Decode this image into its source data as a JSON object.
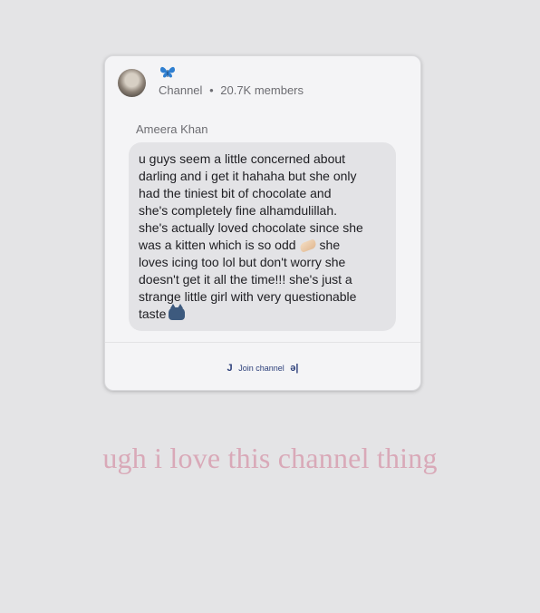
{
  "channel": {
    "label": "Channel",
    "separator": "•",
    "members": "20.7K members"
  },
  "message": {
    "author": "Ameera Khan",
    "lines": [
      "u guys seem a little concerned about",
      "darling and i get it hahaha but she only",
      "had the tiniest bit of chocolate and",
      "she's completely fine alhamdulillah.",
      "she's actually loved chocolate since she",
      "was a kitten which is so odd",
      "she",
      "loves icing too lol but don't worry she",
      "doesn't get it all the time!!! she's just a",
      "strange little girl with very questionable",
      "taste"
    ]
  },
  "join": {
    "left_glyph": "J",
    "label": "Join channel",
    "right_glyph": "ǝ|"
  },
  "caption": "ugh i love this channel thing",
  "colors": {
    "background": "#e4e4e6",
    "card": "#f4f4f6",
    "bubble": "#e3e3e6",
    "caption": "#d9a9b8",
    "butterfly": "#2f7fd1"
  }
}
